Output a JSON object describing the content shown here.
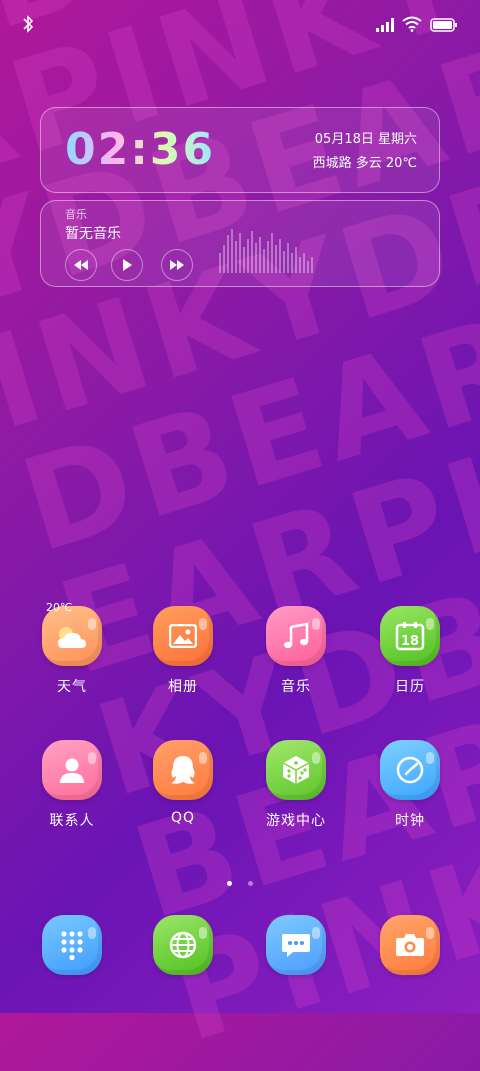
{
  "wallpaper": {
    "text_lines": [
      "DBEARPINKY",
      "RPINKYDBEAR",
      "YDBEARPINKY",
      "INKYDBEARPI",
      "DBEARPINKYD",
      "EARPINKYDBE",
      "KYDBEARPINK",
      "BEARPINKYDB",
      "PINKYDBEARP",
      "ARPINKYDBEA"
    ]
  },
  "status_bar": {
    "bluetooth_icon": "bluetooth-icon",
    "signal_icon": "signal-icon",
    "wifi_icon": "wifi-icon",
    "battery_icon": "battery-icon"
  },
  "clock_widget": {
    "time": "02:36",
    "date": "05月18日  星期六",
    "weather": "西城路  多云  20℃"
  },
  "music_widget": {
    "title": "音乐",
    "song": "暂无音乐"
  },
  "apps": [
    {
      "label": "天气",
      "icon": "weather-icon",
      "badge": "20℃",
      "color": "#ffa36a"
    },
    {
      "label": "相册",
      "icon": "gallery-icon",
      "color": "#ff8a4a"
    },
    {
      "label": "音乐",
      "icon": "music-note-icon",
      "color": "#ff6fa8"
    },
    {
      "label": "日历",
      "icon": "calendar-icon",
      "badge": "18",
      "color": "#6fd13a"
    },
    {
      "label": "联系人",
      "icon": "contacts-icon",
      "color": "#ff7fa8"
    },
    {
      "label": "QQ",
      "icon": "qq-icon",
      "color": "#ff8a4a"
    },
    {
      "label": "游戏中心",
      "icon": "dice-icon",
      "color": "#7bd43f"
    },
    {
      "label": "时钟",
      "icon": "clock-icon",
      "color": "#4fb8ff"
    }
  ],
  "dock": [
    {
      "icon": "dialpad-icon",
      "color": "#4ab4ff"
    },
    {
      "icon": "browser-globe-icon",
      "color": "#6fd13a"
    },
    {
      "icon": "messages-icon",
      "color": "#4ab4ff"
    },
    {
      "icon": "camera-icon",
      "color": "#ff8a4a"
    }
  ],
  "page_indicator": {
    "pages": 2,
    "current": 1
  }
}
